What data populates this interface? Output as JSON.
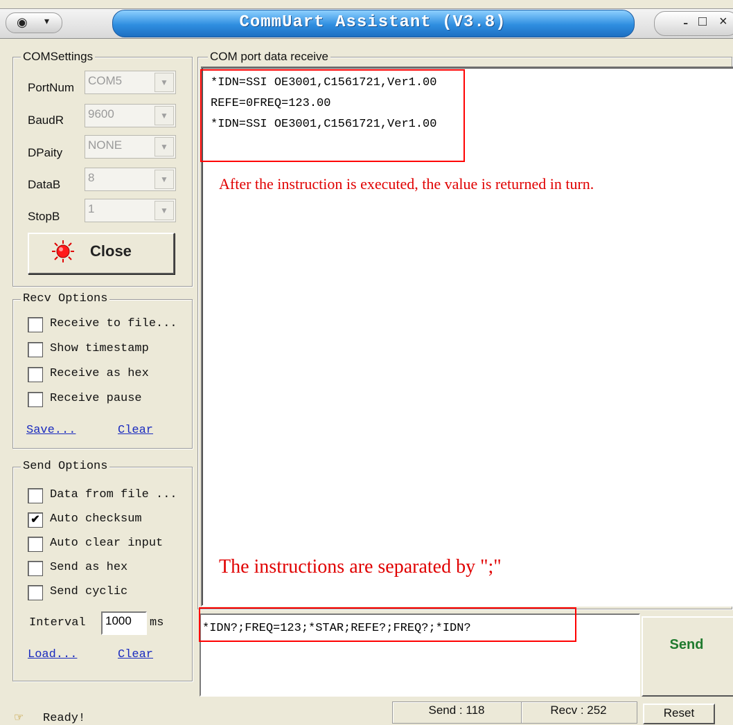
{
  "window": {
    "title": "CommUart Assistant (V3.8)",
    "system_menu_icon": "ww-logo-icon",
    "buttons": {
      "minimize": "-",
      "maximize": "□",
      "close": "×"
    }
  },
  "com_settings": {
    "group_label": "COMSettings",
    "fields": [
      {
        "label": "PortNum",
        "value": "COM5"
      },
      {
        "label": "BaudR",
        "value": "9600"
      },
      {
        "label": "DPaity",
        "value": "NONE"
      },
      {
        "label": "DataB",
        "value": "8"
      },
      {
        "label": "StopB",
        "value": "1"
      }
    ],
    "close_button": "Close"
  },
  "recv_options": {
    "group_label": "Recv Options",
    "items": [
      {
        "label": "Receive to file...",
        "checked": false
      },
      {
        "label": "Show timestamp",
        "checked": false
      },
      {
        "label": "Receive as hex",
        "checked": false
      },
      {
        "label": "Receive pause",
        "checked": false
      }
    ],
    "save_link": "Save...",
    "clear_link": "Clear"
  },
  "send_options": {
    "group_label": "Send Options",
    "items": [
      {
        "label": "Data from file ...",
        "checked": false
      },
      {
        "label": "Auto checksum",
        "checked": true
      },
      {
        "label": "Auto clear input",
        "checked": false
      },
      {
        "label": "Send as hex",
        "checked": false
      },
      {
        "label": "Send cyclic",
        "checked": false
      }
    ],
    "interval_label": "Interval",
    "interval_value": "1000",
    "interval_unit": "ms",
    "load_link": "Load...",
    "clear_link": "Clear"
  },
  "receive_panel": {
    "group_label": "COM port data receive",
    "lines": [
      "*IDN=SSI OE3001,C1561721,Ver1.00",
      "REFE=0FREQ=123.00",
      "*IDN=SSI OE3001,C1561721,Ver1.00"
    ],
    "annotation": "After the instruction is executed, the value is returned in turn."
  },
  "send_panel": {
    "annotation": "The instructions are separated by \";\"",
    "input_value": "*IDN?;FREQ=123;*STAR;REFE?;FREQ?;*IDN?",
    "send_button": "Send"
  },
  "status_bar": {
    "status": "Ready!",
    "send_count": "Send : 118",
    "recv_count": "Recv : 252",
    "reset_button": "Reset"
  },
  "colors": {
    "annotation_red": "#e00000",
    "highlight_red": "#ff0000",
    "send_green": "#1f7a2e",
    "title_blue": "#2f8ee0"
  }
}
